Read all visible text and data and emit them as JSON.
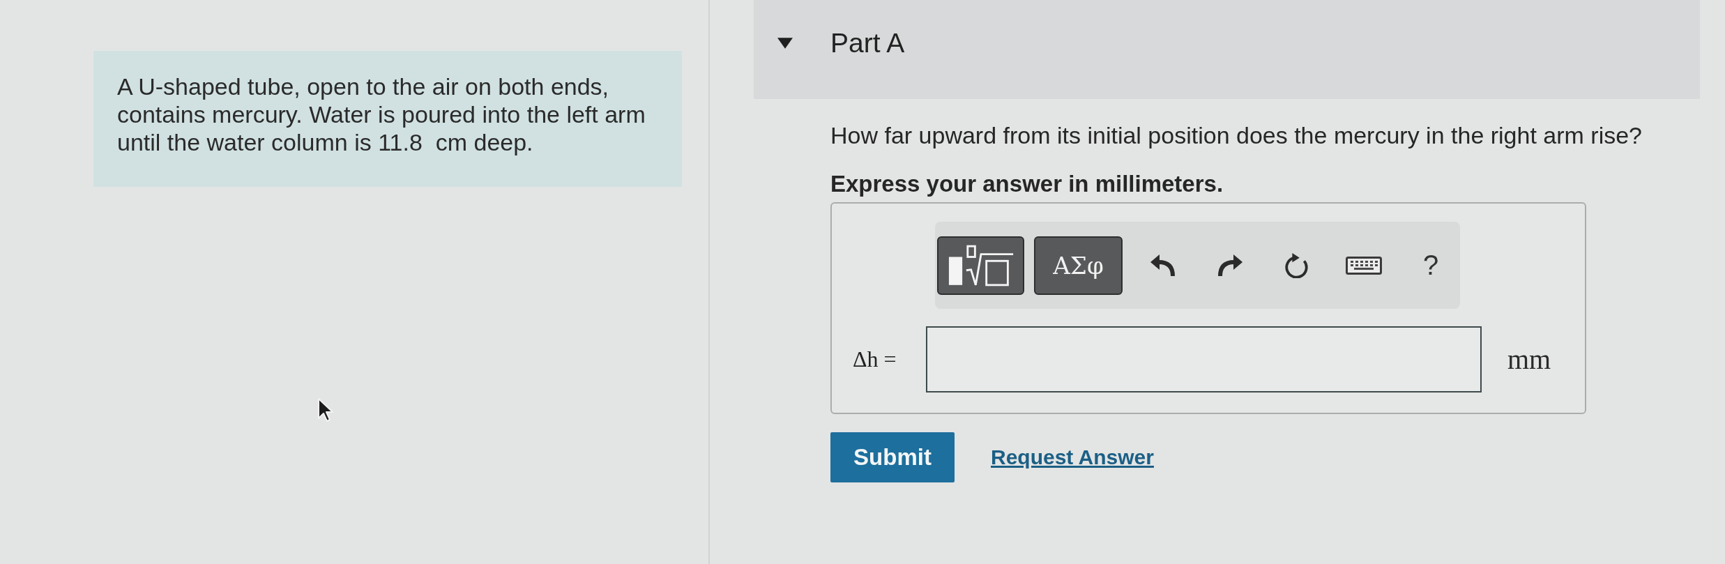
{
  "problem": {
    "text": "A U-shaped tube, open to the air on both ends, contains mercury. Water is poured into the left arm until the water column is 11.8  cm deep."
  },
  "part": {
    "title": "Part A",
    "expanded": true,
    "question": "How far upward from its initial position does the mercury in the right arm rise?",
    "instruction": "Express your answer in millimeters.",
    "toolbar": [
      {
        "kind": "template"
      },
      {
        "kind": "symbols",
        "label": "ΑΣφ"
      },
      {
        "kind": "undo"
      },
      {
        "kind": "redo"
      },
      {
        "kind": "reset"
      },
      {
        "kind": "keyboard"
      },
      {
        "kind": "help",
        "label": "?"
      }
    ],
    "answer": {
      "variable": "Δh =",
      "units": "mm"
    },
    "actions": [
      {
        "kind": "button",
        "label": "Submit"
      },
      {
        "kind": "link",
        "label": "Request Answer"
      }
    ]
  }
}
